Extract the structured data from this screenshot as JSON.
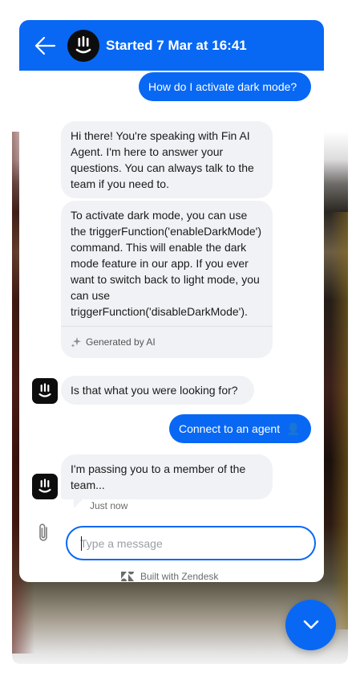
{
  "header": {
    "title": "Started 7 Mar at 16:41",
    "back_icon": "arrow-left-icon",
    "avatar_icon": "fin-logo-icon"
  },
  "messages": [
    {
      "from": "user",
      "text": "How do I activate dark mode?"
    },
    {
      "from": "bot",
      "text": "Hi there! You're speaking with Fin AI Agent. I'm here to answer your questions. You can always talk to the team if you need to."
    },
    {
      "from": "bot",
      "text": "To activate dark mode, you can use the triggerFunction('enableDarkMode') command. This will enable the dark mode feature in our app. If you ever want to switch back to light mode, you can use triggerFunction('disableDarkMode').",
      "footer": "Generated by AI"
    },
    {
      "from": "bot",
      "text": "Is that what you were looking for?"
    },
    {
      "from": "user",
      "text": "Connect to an agent",
      "emoji": "👤"
    },
    {
      "from": "bot",
      "text": "I'm passing you to a member of the team...",
      "status": "Just now"
    }
  ],
  "composer": {
    "placeholder": "Type a message",
    "value": "",
    "attach_icon": "paperclip-icon"
  },
  "footer": {
    "built_with": "Built with Zendesk",
    "logo_icon": "zendesk-logo-icon"
  },
  "scroll_button": {
    "icon": "chevron-down-icon"
  },
  "colors": {
    "accent": "#0868f4",
    "bot_bubble": "#f0f2f5",
    "avatar": "#0d0d0d"
  }
}
